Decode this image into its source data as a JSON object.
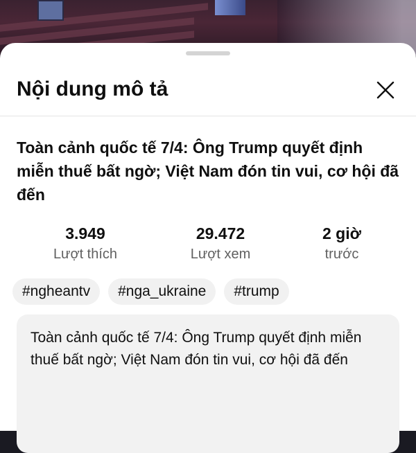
{
  "header": {
    "title": "Nội dung mô tả",
    "close_icon": "close-icon"
  },
  "video": {
    "title": "Toàn cảnh quốc tế 7/4: Ông Trump quyết định miễn thuế bất ngờ; Việt Nam đón tin vui, cơ hội đã đến"
  },
  "stats": [
    {
      "value": "3.949",
      "label": "Lượt thích"
    },
    {
      "value": "29.472",
      "label": "Lượt xem"
    },
    {
      "value": "2 giờ",
      "label": "trước"
    }
  ],
  "tags": [
    "#ngheantv",
    "#nga_ukraine",
    "#trump"
  ],
  "description": {
    "text": "Toàn cảnh quốc tế 7/4: Ông Trump quyết định miễn thuế bất ngờ; Việt Nam đón tin vui, cơ hội đã đến"
  },
  "colors": {
    "sheet_bg": "#ffffff",
    "text_primary": "#0f0f0f",
    "text_secondary": "#606060",
    "chip_bg": "#f1f1f1",
    "desc_bg": "#f2f2f2"
  }
}
